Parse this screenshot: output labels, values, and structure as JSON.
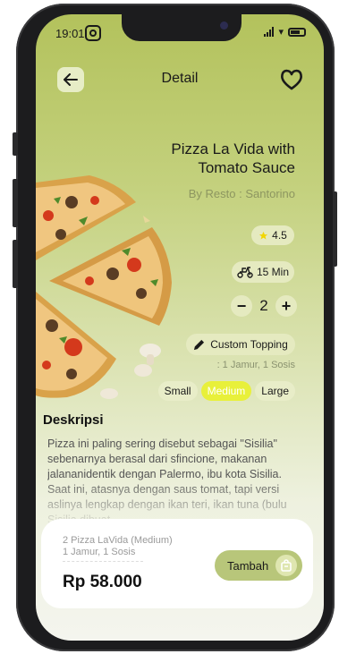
{
  "status_bar": {
    "time": "19:01"
  },
  "header": {
    "title": "Detail"
  },
  "product": {
    "name": "Pizza La Vida with Tomato Sauce",
    "resto": "By Resto : Santorino",
    "rating": "4.5",
    "delivery_time": "15 Min",
    "quantity": "2"
  },
  "topping": {
    "button_label": "Custom Topping",
    "selected": ": 1 Jamur, 1 Sosis"
  },
  "sizes": {
    "options": [
      "Small",
      "Medium",
      "Large"
    ],
    "selected": "Medium"
  },
  "description": {
    "title": "Deskripsi",
    "text": "Pizza ini paling sering disebut sebagai \"Sisilia\" sebenarnya berasal dari sfincione, makanan jalananidentik dengan Palermo, ibu kota Sisilia. Saat ini, atasnya dengan saus tomat, tapi versi aslinya lengkap dengan ikan teri, ikan tuna (bulu Sisilia dibuat"
  },
  "cart": {
    "item": "2 Pizza LaVida (Medium)",
    "topping": "1 Jamur, 1 Sosis",
    "price": "Rp 58.000",
    "button_label": "Tambah"
  },
  "colors": {
    "accent_green": "#b3c25c",
    "chip_bg": "#e5eac0",
    "size_selected": "#e8f03a",
    "star": "#f2d600"
  },
  "icons": [
    "arrow-left-icon",
    "heart-icon",
    "star-icon",
    "scooter-icon",
    "minus-icon",
    "plus-icon",
    "pencil-icon",
    "shopping-bag-icon",
    "instagram-icon",
    "signal-icon",
    "wifi-icon",
    "battery-icon"
  ]
}
